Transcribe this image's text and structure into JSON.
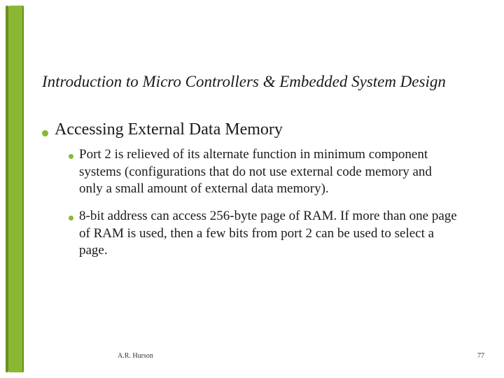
{
  "title": "Introduction to Micro Controllers & Embedded System Design",
  "bullet_main": "Accessing External Data Memory",
  "subbullets": [
    "Port 2 is relieved of its alternate function in minimum component systems (configurations that do not use external code memory and only a small amount of external data memory).",
    "8-bit address can access 256-byte page of RAM.  If more than one page of RAM is used, then a few bits from port 2 can be used to select a page."
  ],
  "footer": {
    "author": "A.R. Hurson",
    "page": "77"
  }
}
